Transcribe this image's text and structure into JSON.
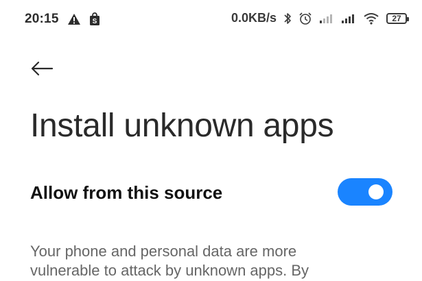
{
  "status_bar": {
    "time": "20:15",
    "left_icons": [
      "warning-icon",
      "shopping-bag-icon"
    ],
    "net_speed": "0.0KB/s",
    "right_icons": [
      "bluetooth-icon",
      "alarm-icon",
      "signal-weak-icon",
      "signal-icon",
      "wifi-icon",
      "battery-icon"
    ],
    "battery_level": "27"
  },
  "header": {
    "back_icon": "back-arrow-icon",
    "title": "Install unknown apps"
  },
  "setting": {
    "label": "Allow from this source",
    "enabled": true
  },
  "description": {
    "line1": "Your phone and personal data are more",
    "line2": "vulnerable to attack by unknown apps. By"
  },
  "colors": {
    "accent": "#1a84ff",
    "text_primary": "#111111",
    "text_secondary": "#666666",
    "background": "#ffffff"
  }
}
